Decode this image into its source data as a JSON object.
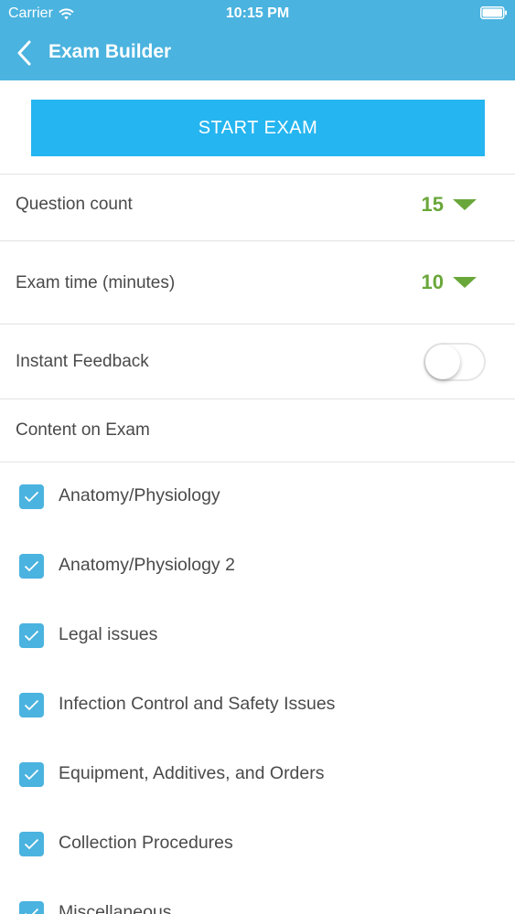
{
  "status_bar": {
    "carrier": "Carrier",
    "time": "10:15 PM"
  },
  "nav": {
    "title": "Exam Builder"
  },
  "start_button": {
    "label": "START EXAM"
  },
  "settings": {
    "question_count": {
      "label": "Question count",
      "value": "15"
    },
    "exam_time": {
      "label": "Exam time (minutes)",
      "value": "10"
    },
    "instant_feedback": {
      "label": "Instant Feedback",
      "enabled": false
    }
  },
  "content": {
    "heading": "Content on Exam",
    "categories": [
      {
        "label": "Anatomy/Physiology",
        "checked": true
      },
      {
        "label": "Anatomy/Physiology 2",
        "checked": true
      },
      {
        "label": "Legal issues",
        "checked": true
      },
      {
        "label": "Infection Control and Safety Issues",
        "checked": true
      },
      {
        "label": "Equipment, Additives, and Orders",
        "checked": true
      },
      {
        "label": "Collection Procedures",
        "checked": true
      },
      {
        "label": "Miscellaneous",
        "checked": true
      }
    ]
  },
  "colors": {
    "header": "#4ab3df",
    "button": "#25b5f0",
    "accent_green": "#6aa73a",
    "checkbox": "#4ab3df"
  }
}
